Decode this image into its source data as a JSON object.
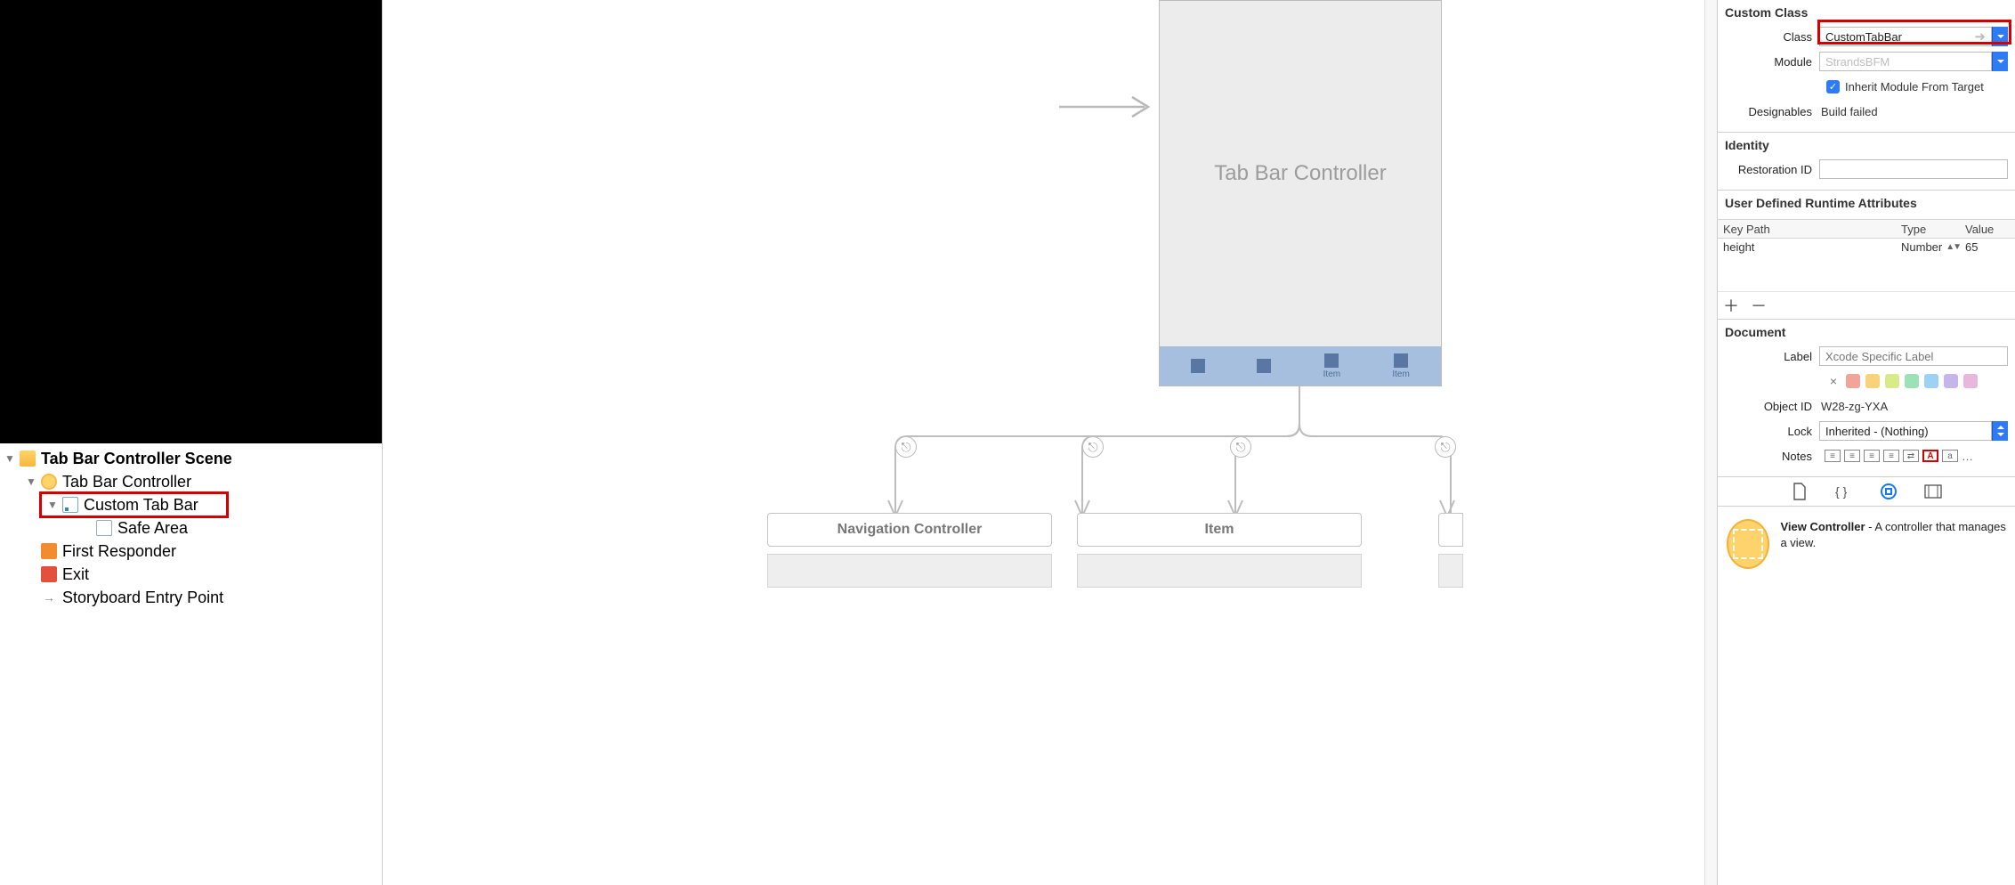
{
  "outline": {
    "scene": "Tab Bar Controller Scene",
    "controller": "Tab Bar Controller",
    "custom_tab_bar": "Custom Tab Bar",
    "safe_area": "Safe Area",
    "first_responder": "First Responder",
    "exit": "Exit",
    "entry_point": "Storyboard Entry Point"
  },
  "canvas": {
    "tbc_title": "Tab Bar Controller",
    "tab_caption_item": "Item",
    "mini_nav": "Navigation Controller",
    "mini_item": "Item"
  },
  "inspector": {
    "custom_class": {
      "title": "Custom Class",
      "class_label": "Class",
      "class_value": "CustomTabBar",
      "module_label": "Module",
      "module_placeholder": "StrandsBFM",
      "inherit_label": "Inherit Module From Target",
      "designables_label": "Designables",
      "designables_value": "Build failed"
    },
    "identity": {
      "title": "Identity",
      "restoration_label": "Restoration ID"
    },
    "runtime_attrs": {
      "title": "User Defined Runtime Attributes",
      "col_key": "Key Path",
      "col_type": "Type",
      "col_value": "Value",
      "row_key": "height",
      "row_type": "Number",
      "row_value": "65"
    },
    "document": {
      "title": "Document",
      "label_label": "Label",
      "label_placeholder": "Xcode Specific Label",
      "object_id_label": "Object ID",
      "object_id_value": "W28-zg-YXA",
      "lock_label": "Lock",
      "lock_value": "Inherited - (Nothing)",
      "notes_label": "Notes",
      "swatches": [
        "#f2a39a",
        "#f8d37a",
        "#d9ea8b",
        "#9de2b6",
        "#9ed2f5",
        "#c6b5ea",
        "#e7b7dc"
      ]
    },
    "library": {
      "title": "View Controller",
      "desc": " - A controller that manages a view."
    }
  }
}
